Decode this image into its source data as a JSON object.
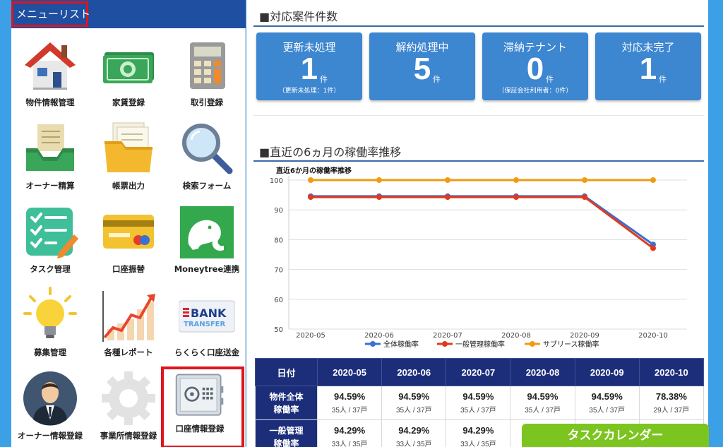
{
  "menu": {
    "title": "メニューリスト",
    "items": [
      {
        "label": "物件情報管理",
        "icon": "house-icon"
      },
      {
        "label": "家賃登録",
        "icon": "banknote-icon"
      },
      {
        "label": "取引登録",
        "icon": "calculator-icon"
      },
      {
        "label": "オーナー精算",
        "icon": "inbox-tray-icon"
      },
      {
        "label": "帳票出力",
        "icon": "folder-documents-icon"
      },
      {
        "label": "検索フォーム",
        "icon": "magnifier-icon"
      },
      {
        "label": "タスク管理",
        "icon": "checklist-icon"
      },
      {
        "label": "口座振替",
        "icon": "credit-card-icon"
      },
      {
        "label": "Moneytree連携",
        "icon": "elephant-icon"
      },
      {
        "label": "募集管理",
        "icon": "lightbulb-icon"
      },
      {
        "label": "各種レポート",
        "icon": "growth-chart-icon"
      },
      {
        "label": "らくらく口座送金",
        "icon": "bank-transfer-icon",
        "icon_text_1": "BANK",
        "icon_text_2": "TRANSFER"
      },
      {
        "label": "オーナー情報登録",
        "icon": "businessman-avatar-icon"
      },
      {
        "label": "事業所情報登録",
        "icon": "gear-icon"
      },
      {
        "label": "口座情報登録",
        "icon": "safe-icon"
      }
    ]
  },
  "cases": {
    "title": "■対応案件件数",
    "cards": [
      {
        "title": "更新未処理",
        "count": "1",
        "unit": "件",
        "sub": "（更新未処理：1件）"
      },
      {
        "title": "解約処理中",
        "count": "5",
        "unit": "件",
        "sub": ""
      },
      {
        "title": "滞納テナント",
        "count": "0",
        "unit": "件",
        "sub": "（保証会社利用者：0件）"
      },
      {
        "title": "対応未完了",
        "count": "1",
        "unit": "件",
        "sub": ""
      }
    ]
  },
  "occupancy": {
    "title": "■直近の6ヵ月の稼働率推移"
  },
  "chart_data": {
    "type": "line",
    "title": "直近6か月の稼働率推移",
    "x": [
      "2020-05",
      "2020-06",
      "2020-07",
      "2020-08",
      "2020-09",
      "2020-10"
    ],
    "series": [
      {
        "name": "全体稼働率",
        "values": [
          94.59,
          94.59,
          94.59,
          94.59,
          94.59,
          78.38
        ],
        "color": "#3c6fd1"
      },
      {
        "name": "一般管理稼働率",
        "values": [
          94.29,
          94.29,
          94.29,
          94.29,
          94.29,
          77.14
        ],
        "color": "#e03a1e"
      },
      {
        "name": "サブリース稼働率",
        "values": [
          100,
          100,
          100,
          100,
          100,
          100
        ],
        "color": "#f29a12"
      }
    ],
    "ylim": [
      50,
      100
    ],
    "yticks": [
      "50",
      "60",
      "70",
      "80",
      "90",
      "100"
    ],
    "grid": true,
    "legend": "bottom"
  },
  "table": {
    "header_label": "日付",
    "months": [
      "2020-05",
      "2020-06",
      "2020-07",
      "2020-08",
      "2020-09",
      "2020-10"
    ],
    "rows": [
      {
        "label_1": "物件全体",
        "label_2": "稼働率",
        "cells": [
          {
            "pct": "94.59%",
            "sub": "35人 / 37戸"
          },
          {
            "pct": "94.59%",
            "sub": "35人 / 37戸"
          },
          {
            "pct": "94.59%",
            "sub": "35人 / 37戸"
          },
          {
            "pct": "94.59%",
            "sub": "35人 / 37戸"
          },
          {
            "pct": "94.59%",
            "sub": "35人 / 37戸"
          },
          {
            "pct": "78.38%",
            "sub": "29人 / 37戸"
          }
        ]
      },
      {
        "label_1": "一般管理",
        "label_2": "稼働率",
        "cells": [
          {
            "pct": "94.29%",
            "sub": "33人 / 35戸"
          },
          {
            "pct": "94.29%",
            "sub": "33人 / 35戸"
          },
          {
            "pct": "94.29%",
            "sub": "33人 / 35戸"
          },
          {
            "pct": "",
            "sub": ""
          },
          {
            "pct": "",
            "sub": ""
          },
          {
            "pct": "",
            "sub": ""
          }
        ]
      }
    ]
  },
  "task_calendar": {
    "label": "タスクカレンダー"
  },
  "colors": {
    "accent": "#1f4fa0",
    "card": "#3d86d0",
    "table_header": "#1c2e7a",
    "highlight": "#e0141c",
    "task_button": "#7cc420"
  }
}
